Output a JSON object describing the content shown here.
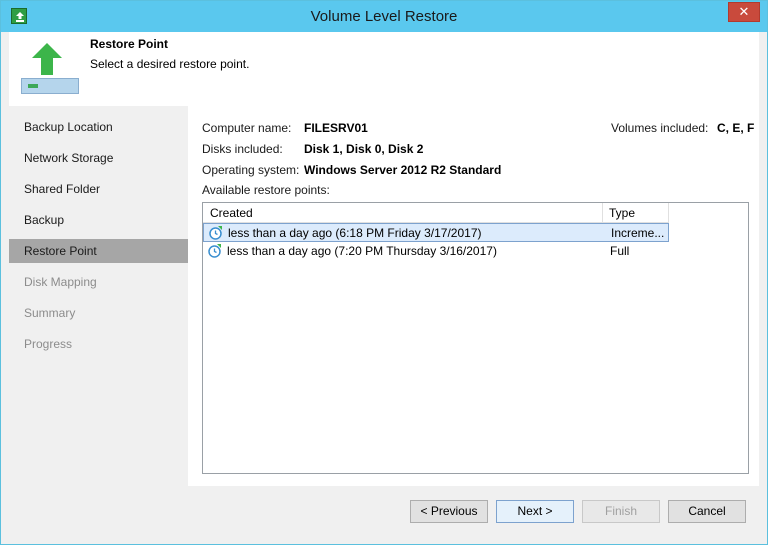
{
  "window": {
    "title": "Volume Level Restore",
    "close_glyph": "✕"
  },
  "header": {
    "title": "Restore Point",
    "description": "Select a desired restore point."
  },
  "sidebar": {
    "items": [
      {
        "label": "Backup Location",
        "state": "normal"
      },
      {
        "label": "Network Storage",
        "state": "normal"
      },
      {
        "label": "Shared Folder",
        "state": "normal"
      },
      {
        "label": "Backup",
        "state": "normal"
      },
      {
        "label": "Restore Point",
        "state": "active"
      },
      {
        "label": "Disk Mapping",
        "state": "disabled"
      },
      {
        "label": "Summary",
        "state": "disabled"
      },
      {
        "label": "Progress",
        "state": "disabled"
      }
    ]
  },
  "info": {
    "computer_name_label": "Computer name:",
    "computer_name": "FILESRV01",
    "disks_label": "Disks included:",
    "disks": "Disk 1, Disk 0, Disk 2",
    "os_label": "Operating system:",
    "os": "Windows Server 2012 R2 Standard",
    "volumes_label": "Volumes included:",
    "volumes": "C, E, F",
    "restore_points_label": "Available restore points:"
  },
  "list": {
    "columns": [
      "Created",
      "Type"
    ],
    "rows": [
      {
        "created": "less than a day ago (6:18 PM Friday 3/17/2017)",
        "type": "Increme...",
        "selected": true
      },
      {
        "created": "less than a day ago (7:20 PM Thursday 3/16/2017)",
        "type": "Full",
        "selected": false
      }
    ]
  },
  "buttons": {
    "previous": "< Previous",
    "next": "Next >",
    "finish": "Finish",
    "cancel": "Cancel"
  },
  "colors": {
    "titlebar": "#5ac8ee",
    "active_nav": "#a6a6a6",
    "selected_row": "#dcebfc",
    "close_button": "#c94a3c"
  }
}
